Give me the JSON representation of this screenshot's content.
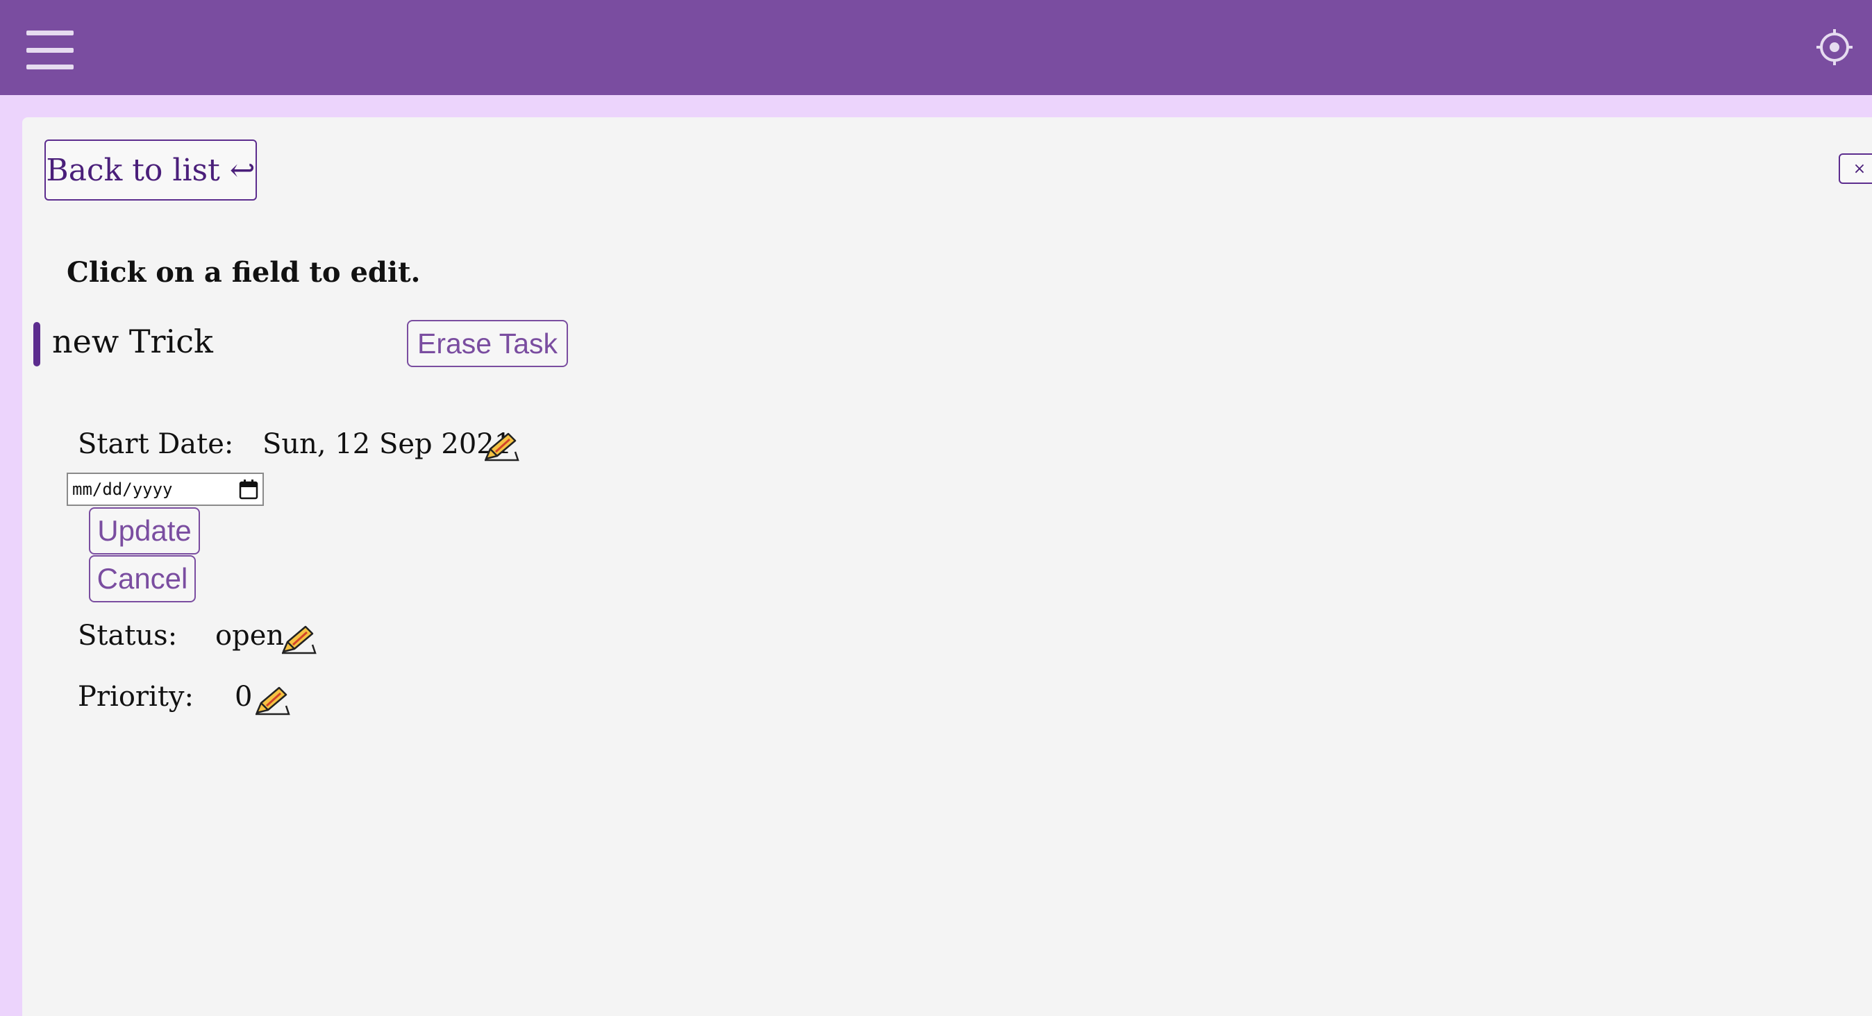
{
  "header": {
    "menu_icon": "hamburger-menu-icon",
    "settings_icon": "gear-icon",
    "colors": {
      "bar": "#7a4da0",
      "background": "#ecd4fc"
    }
  },
  "panel": {
    "back_label": "Back to list ↩",
    "close_label": "×",
    "hint": "Click on a field to edit."
  },
  "task": {
    "title": "new Trick",
    "erase_label": "Erase Task",
    "accent_color": "#5c2c8e"
  },
  "fields": {
    "start_date": {
      "label": "Start Date:",
      "value": "Sun, 12 Sep 2021"
    },
    "date_input": {
      "placeholder": "mm/dd/yyyy"
    },
    "update_label": "Update",
    "cancel_label": "Cancel",
    "status": {
      "label": "Status:",
      "value": "open"
    },
    "priority": {
      "label": "Priority:",
      "value": "0"
    },
    "edit_icon": "pencil-writing-icon"
  }
}
